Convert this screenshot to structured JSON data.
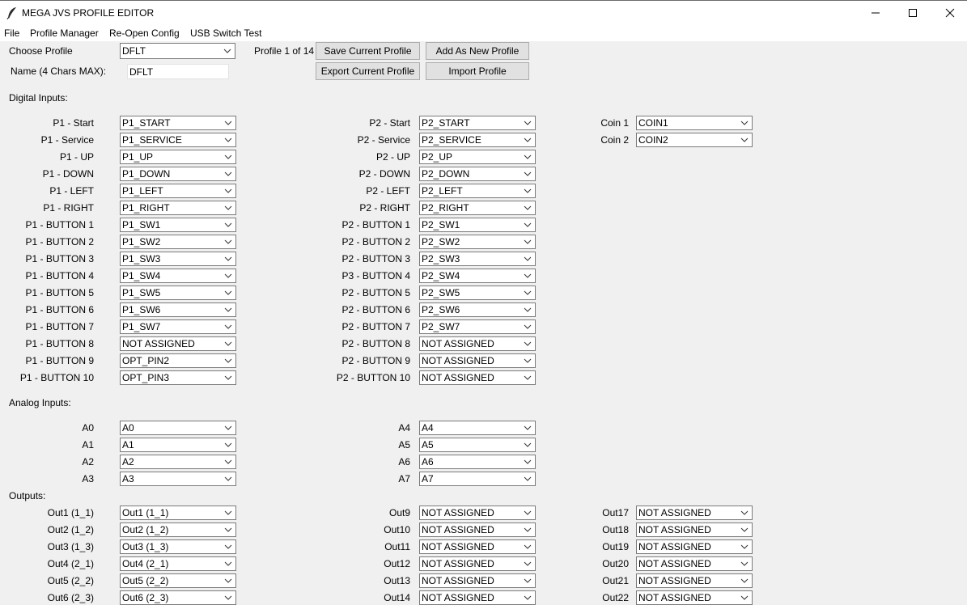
{
  "window": {
    "title": "MEGA JVS PROFILE EDITOR",
    "icon": "feather-icon",
    "controls": [
      "minimize-icon",
      "maximize-icon",
      "close-icon"
    ]
  },
  "menu": [
    "File",
    "Profile Manager",
    "Re-Open Config",
    "USB Switch Test"
  ],
  "profile": {
    "choose_label": "Choose Profile",
    "selected": "DFLT",
    "counter": "Profile 1 of 14",
    "name_label": "Name (4 Chars MAX):",
    "name_value": "DFLT",
    "buttons": [
      "Save Current Profile",
      "Add As New Profile",
      "Export Current Profile",
      "Import Profile"
    ]
  },
  "digital": {
    "heading": "Digital Inputs:",
    "p1": [
      {
        "label": "P1 - Start",
        "value": "P1_START"
      },
      {
        "label": "P1 - Service",
        "value": "P1_SERVICE"
      },
      {
        "label": "P1 - UP",
        "value": "P1_UP"
      },
      {
        "label": "P1 - DOWN",
        "value": "P1_DOWN"
      },
      {
        "label": "P1 - LEFT",
        "value": "P1_LEFT"
      },
      {
        "label": "P1 - RIGHT",
        "value": "P1_RIGHT"
      },
      {
        "label": "P1 - BUTTON 1",
        "value": "P1_SW1"
      },
      {
        "label": "P1 - BUTTON 2",
        "value": "P1_SW2"
      },
      {
        "label": "P1 - BUTTON 3",
        "value": "P1_SW3"
      },
      {
        "label": "P1 - BUTTON 4",
        "value": "P1_SW4"
      },
      {
        "label": "P1 - BUTTON 5",
        "value": "P1_SW5"
      },
      {
        "label": "P1 - BUTTON 6",
        "value": "P1_SW6"
      },
      {
        "label": "P1 - BUTTON 7",
        "value": "P1_SW7"
      },
      {
        "label": "P1 - BUTTON 8",
        "value": "NOT ASSIGNED"
      },
      {
        "label": "P1 - BUTTON 9",
        "value": "OPT_PIN2"
      },
      {
        "label": "P1 - BUTTON 10",
        "value": "OPT_PIN3"
      }
    ],
    "p2": [
      {
        "label": "P2 - Start",
        "value": "P2_START"
      },
      {
        "label": "P2 - Service",
        "value": "P2_SERVICE"
      },
      {
        "label": "P2 - UP",
        "value": "P2_UP"
      },
      {
        "label": "P2 - DOWN",
        "value": "P2_DOWN"
      },
      {
        "label": "P2 - LEFT",
        "value": "P2_LEFT"
      },
      {
        "label": "P2 - RIGHT",
        "value": "P2_RIGHT"
      },
      {
        "label": "P2 - BUTTON 1",
        "value": "P2_SW1"
      },
      {
        "label": "P2 - BUTTON 2",
        "value": "P2_SW2"
      },
      {
        "label": "P2 - BUTTON 3",
        "value": "P2_SW3"
      },
      {
        "label": "P3 - BUTTON 4",
        "value": "P2_SW4"
      },
      {
        "label": "P2 - BUTTON 5",
        "value": "P2_SW5"
      },
      {
        "label": "P2 - BUTTON 6",
        "value": "P2_SW6"
      },
      {
        "label": "P2 - BUTTON 7",
        "value": "P2_SW7"
      },
      {
        "label": "P2 - BUTTON 8",
        "value": "NOT ASSIGNED"
      },
      {
        "label": "P2 - BUTTON 9",
        "value": "NOT ASSIGNED"
      },
      {
        "label": "P2 - BUTTON 10",
        "value": "NOT ASSIGNED"
      }
    ],
    "coins": [
      {
        "label": "Coin 1",
        "value": "COIN1"
      },
      {
        "label": "Coin 2",
        "value": "COIN2"
      }
    ]
  },
  "analog": {
    "heading": "Analog Inputs:",
    "left": [
      {
        "label": "A0",
        "value": "A0"
      },
      {
        "label": "A1",
        "value": "A1"
      },
      {
        "label": "A2",
        "value": "A2"
      },
      {
        "label": "A3",
        "value": "A3"
      }
    ],
    "right": [
      {
        "label": "A4",
        "value": "A4"
      },
      {
        "label": "A5",
        "value": "A5"
      },
      {
        "label": "A6",
        "value": "A6"
      },
      {
        "label": "A7",
        "value": "A7"
      }
    ]
  },
  "outputs": {
    "heading": "Outputs:",
    "col1": [
      {
        "label": "Out1 (1_1)",
        "value": "Out1 (1_1)"
      },
      {
        "label": "Out2 (1_2)",
        "value": "Out2 (1_2)"
      },
      {
        "label": "Out3 (1_3)",
        "value": "Out3 (1_3)"
      },
      {
        "label": "Out4 (2_1)",
        "value": "Out4 (2_1)"
      },
      {
        "label": "Out5 (2_2)",
        "value": "Out5 (2_2)"
      },
      {
        "label": "Out6 (2_3)",
        "value": "Out6 (2_3)"
      }
    ],
    "col2": [
      {
        "label": "Out9",
        "value": "NOT ASSIGNED"
      },
      {
        "label": "Out10",
        "value": "NOT ASSIGNED"
      },
      {
        "label": "Out11",
        "value": "NOT ASSIGNED"
      },
      {
        "label": "Out12",
        "value": "NOT ASSIGNED"
      },
      {
        "label": "Out13",
        "value": "NOT ASSIGNED"
      },
      {
        "label": "Out14",
        "value": "NOT ASSIGNED"
      }
    ],
    "col3": [
      {
        "label": "Out17",
        "value": "NOT ASSIGNED"
      },
      {
        "label": "Out18",
        "value": "NOT ASSIGNED"
      },
      {
        "label": "Out19",
        "value": "NOT ASSIGNED"
      },
      {
        "label": "Out20",
        "value": "NOT ASSIGNED"
      },
      {
        "label": "Out21",
        "value": "NOT ASSIGNED"
      },
      {
        "label": "Out22",
        "value": "NOT ASSIGNED"
      }
    ]
  }
}
